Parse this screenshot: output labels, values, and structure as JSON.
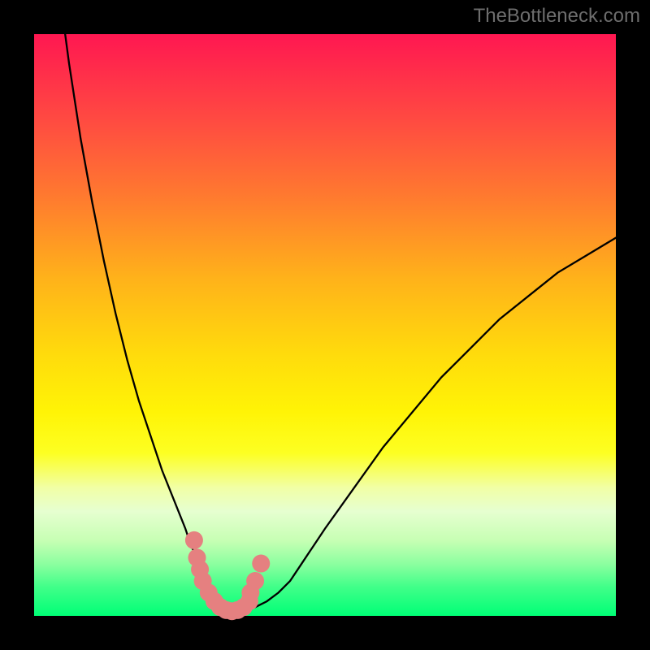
{
  "watermark": "TheBottleneck.com",
  "chart_data": {
    "type": "line",
    "title": "",
    "xlabel": "",
    "ylabel": "",
    "xlim": [
      0,
      100
    ],
    "ylim": [
      0,
      100
    ],
    "x": [
      0,
      2,
      4,
      6,
      8,
      10,
      12,
      14,
      16,
      18,
      20,
      22,
      24,
      26,
      27,
      28,
      29,
      30,
      31,
      32,
      33,
      34,
      35,
      36,
      38,
      40,
      42,
      44,
      46,
      48,
      50,
      55,
      60,
      65,
      70,
      75,
      80,
      85,
      90,
      95,
      100
    ],
    "values": [
      150,
      128,
      110,
      95,
      82,
      71,
      61,
      52,
      44,
      37,
      31,
      25,
      20,
      15,
      12,
      10,
      8,
      6,
      4,
      2.5,
      1.5,
      1,
      0.8,
      1,
      1.5,
      2.5,
      4,
      6,
      9,
      12,
      15,
      22,
      29,
      35,
      41,
      46,
      51,
      55,
      59,
      62,
      65
    ],
    "minimum_x": 34,
    "gradient_top_color": "#ff1751",
    "gradient_bottom_color": "#00ff76",
    "marker_color": "#e58080",
    "marker_points_x": [
      27.5,
      28,
      28.5,
      29,
      30,
      31,
      32,
      33,
      34,
      35,
      36,
      37,
      37.2,
      38,
      39
    ],
    "marker_points_y": [
      13,
      10,
      8,
      6,
      4,
      2.5,
      1.5,
      1,
      0.8,
      1,
      1.5,
      2.5,
      4,
      6,
      9
    ]
  }
}
